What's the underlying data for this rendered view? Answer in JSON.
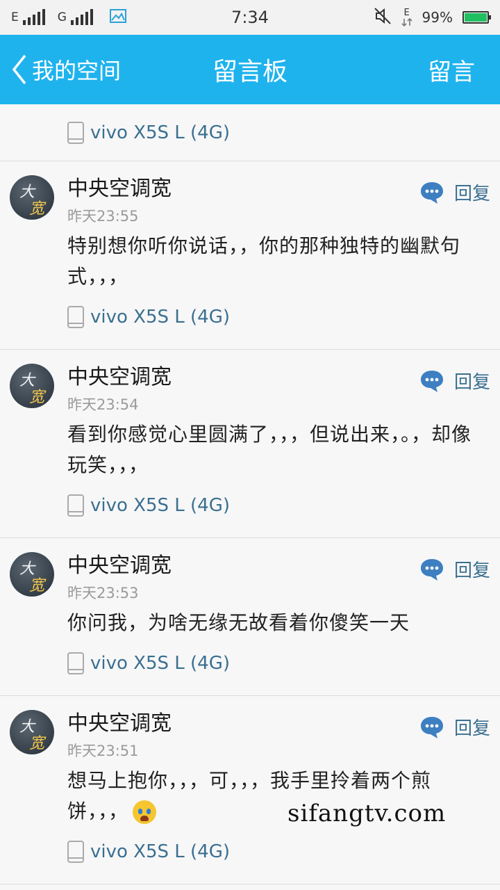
{
  "status_bar": {
    "sim1": "E",
    "sim2": "G",
    "time": "7:34",
    "data_indicator": "E",
    "battery_text": "99%",
    "battery_level": 0.99
  },
  "header": {
    "back_label": "我的空间",
    "title": "留言板",
    "action_label": "留言"
  },
  "first_item": {
    "device": "vivo X5S L (4G)"
  },
  "messages": [
    {
      "author": "中央空调宽",
      "time": "昨天23:55",
      "text": "特别想你听你说话，，你的那种独特的幽默句式，，，",
      "device": "vivo X5S L (4G)",
      "reply_label": "回复"
    },
    {
      "author": "中央空调宽",
      "time": "昨天23:54",
      "text": "看到你感觉心里圆满了，，，但说出来，。，却像玩笑，，，",
      "device": "vivo X5S L (4G)",
      "reply_label": "回复"
    },
    {
      "author": "中央空调宽",
      "time": "昨天23:53",
      "text": "你问我，为啥无缘无故看着你傻笑一天",
      "device": "vivo X5S L (4G)",
      "reply_label": "回复"
    },
    {
      "author": "中央空调宽",
      "time": "昨天23:51",
      "text": "想马上抱你，，，可，，，我手里拎着两个煎饼，，，",
      "emoji": "crying-face",
      "device": "vivo X5S L (4G)",
      "reply_label": "回复"
    }
  ],
  "avatar_text": {
    "top": "大",
    "bottom": "宽"
  },
  "watermark": "sifangtv.com",
  "colors": {
    "header_bg": "#1fb3ee",
    "link": "#3a6f8f",
    "reply_icon": "#3d7fc1",
    "battery": "#20c060"
  }
}
